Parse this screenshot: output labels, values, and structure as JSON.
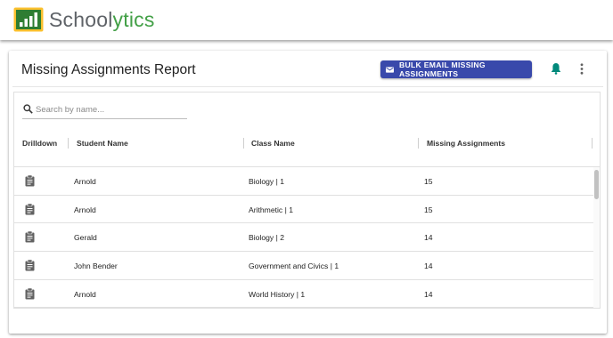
{
  "app": {
    "brand_part1": "School",
    "brand_part2": "ytics",
    "brand_colors": {
      "gray": "#5f6368",
      "green": "#43a047"
    }
  },
  "report": {
    "title": "Missing Assignments Report",
    "bulk_email_label": "BULK EMAIL MISSING ASSIGNMENTS",
    "accent_color": "#3949ab",
    "bell_color": "#00897b"
  },
  "search": {
    "placeholder": "Search by name...",
    "value": ""
  },
  "table": {
    "columns": {
      "drilldown": "Drilldown",
      "student": "Student Name",
      "class": "Class Name",
      "missing": "Missing Assignments"
    },
    "rows": [
      {
        "student": "Arnold",
        "class": "Biology | 1",
        "missing": "15"
      },
      {
        "student": "Arnold",
        "class": "Arithmetic | 1",
        "missing": "15"
      },
      {
        "student": "Gerald",
        "class": "Biology | 2",
        "missing": "14"
      },
      {
        "student": "John Bender",
        "class": "Government and Civics | 1",
        "missing": "14"
      },
      {
        "student": "Arnold",
        "class": "World History | 1",
        "missing": "14"
      }
    ]
  },
  "icons": {
    "logo": "chart-logo-icon",
    "mail": "mail-icon",
    "bell": "bell-icon",
    "more": "more-vert-icon",
    "search": "search-icon",
    "drilldown": "clipboard-icon"
  }
}
